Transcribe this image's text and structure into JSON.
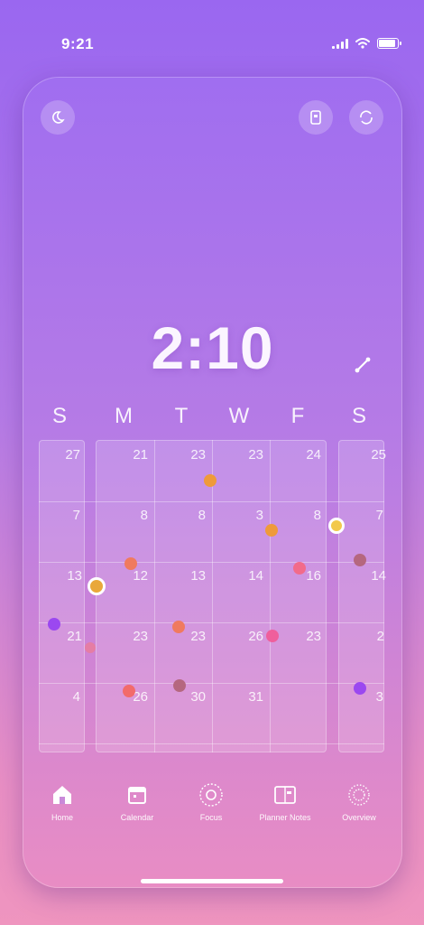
{
  "status": {
    "time": "9:21",
    "battery_level": 0.9
  },
  "header": {
    "left_icon": "moon-icon",
    "right_icons": [
      "device-icon",
      "refresh-icon"
    ]
  },
  "clock": {
    "time": "2:10",
    "expand_icon": "expand-icon"
  },
  "calendar": {
    "weekdays": [
      "S",
      "M",
      "T",
      "W",
      "F",
      "S"
    ],
    "rows": [
      [
        "27",
        "21",
        "23",
        "23",
        "24",
        "25"
      ],
      [
        "7",
        "8",
        "8",
        "3",
        "8",
        "7"
      ],
      [
        "13",
        "12",
        "13",
        "14",
        "16",
        "14"
      ],
      [
        "21",
        "23",
        "23",
        "26",
        "23",
        "2"
      ],
      [
        "4",
        "26",
        "30",
        "31",
        "",
        "3"
      ]
    ],
    "event_colors": {
      "orange": "#ef9a3a",
      "coral": "#f07a5f",
      "pink": "#f26b8a",
      "rose": "#ef5f9c",
      "purple": "#9b48f0",
      "mauve": "#b5677f",
      "yellow": "#f2c94c"
    }
  },
  "tabbar": {
    "tabs": [
      {
        "label": "Home",
        "icon": "home-icon"
      },
      {
        "label": "Calendar",
        "icon": "calendar-icon"
      },
      {
        "label": "Focus",
        "icon": "focus-icon"
      },
      {
        "label": "Planner Notes",
        "icon": "planner-icon"
      },
      {
        "label": "Overview",
        "icon": "overview-icon"
      }
    ]
  }
}
